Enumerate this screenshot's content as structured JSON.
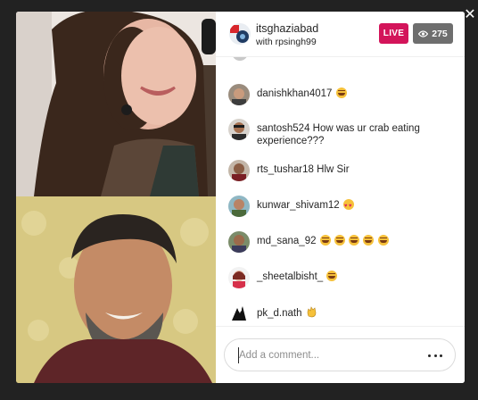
{
  "header": {
    "host_username": "itsghaziabad",
    "host_subtitle": "with rpsingh99",
    "live_label": "LIVE",
    "viewer_count": "275"
  },
  "comments": [
    {
      "user": "danishkhan4017",
      "text": "",
      "emojis": [
        "laugh"
      ]
    },
    {
      "user": "santosh524",
      "text": "How was ur crab eating experience???",
      "emojis": []
    },
    {
      "user": "rts_tushar18",
      "text": "Hlw Sir",
      "emojis": []
    },
    {
      "user": "kunwar_shivam12",
      "text": "",
      "emojis": [
        "heart"
      ]
    },
    {
      "user": "md_sana_92",
      "text": "",
      "emojis": [
        "laugh",
        "laugh",
        "laugh",
        "laugh",
        "laugh"
      ]
    },
    {
      "user": "_sheetalbisht_",
      "text": "",
      "emojis": [
        "laugh"
      ]
    },
    {
      "user": "pk_d.nath",
      "text": "",
      "emojis": [
        "hand"
      ]
    }
  ],
  "footer": {
    "comment_placeholder": "Add a comment..."
  },
  "colors": {
    "live": "#d3145a",
    "viewer_badge": "#6e6e6e",
    "backdrop": "#222222"
  },
  "icons": [
    "close-icon",
    "eye-icon",
    "more-options-icon"
  ]
}
